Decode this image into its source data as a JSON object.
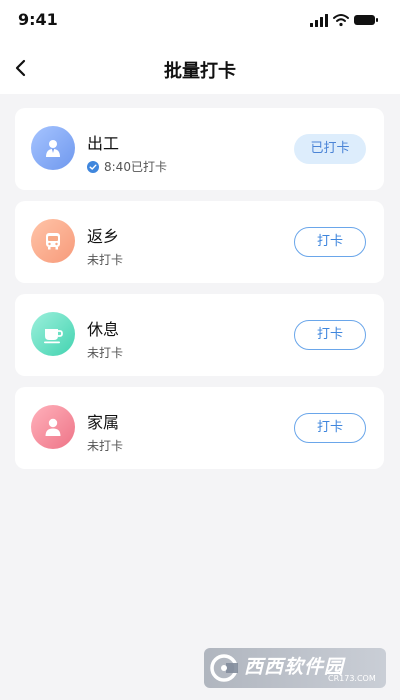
{
  "status_bar": {
    "time": "9:41",
    "signal_icon": "cellular-signal-icon",
    "wifi_icon": "wifi-icon",
    "battery_icon": "battery-icon"
  },
  "nav": {
    "back_icon": "chevron-left-icon",
    "title": "批量打卡"
  },
  "cards": [
    {
      "title": "出工",
      "status": "8:40已打卡",
      "checked": true,
      "icon": "worker-icon",
      "button_label": "已打卡",
      "accent": "#6f98ee"
    },
    {
      "title": "返乡",
      "status": "未打卡",
      "checked": false,
      "icon": "bus-icon",
      "button_label": "打卡",
      "accent": "#f79a7a"
    },
    {
      "title": "休息",
      "status": "未打卡",
      "checked": false,
      "icon": "coffee-cup-icon",
      "button_label": "打卡",
      "accent": "#43d3b0"
    },
    {
      "title": "家属",
      "status": "未打卡",
      "checked": false,
      "icon": "person-icon",
      "button_label": "打卡",
      "accent": "#ee7487"
    }
  ],
  "watermark": {
    "text": "西西软件园",
    "sub": "CR173.COM"
  },
  "colors": {
    "primary": "#3f86dd",
    "background": "#f4f4f6"
  }
}
